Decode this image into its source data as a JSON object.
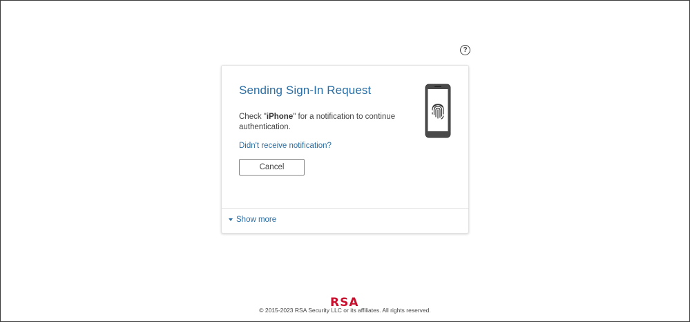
{
  "help": {
    "icon": "question-circle-icon",
    "glyph": "?"
  },
  "card": {
    "title": "Sending Sign-In Request",
    "message_prefix": "Check \"",
    "device_name": "iPhone",
    "message_suffix": "\" for a notification to continue authentication.",
    "link_label": "Didn't receive notification?",
    "cancel_label": "Cancel",
    "show_more_label": "Show more",
    "phone_icon": "phone-fingerprint-icon"
  },
  "footer": {
    "logo": "RSA",
    "copyright": "© 2015-2023 RSA Security LLC or its affiliates. All rights reserved."
  },
  "colors": {
    "accent": "#2a6ea3",
    "brand": "#c8102e"
  }
}
